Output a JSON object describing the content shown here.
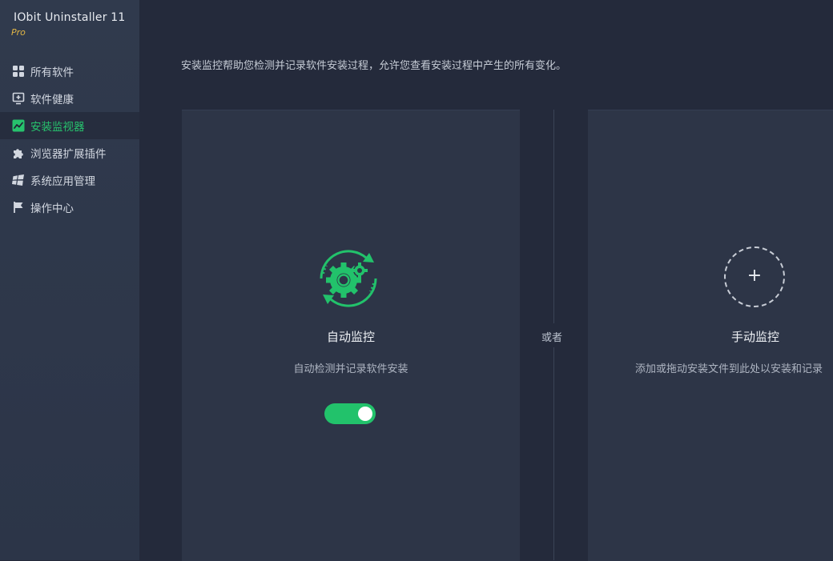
{
  "app": {
    "title": "IObit Uninstaller 11",
    "edition": "Pro"
  },
  "sidebar": {
    "items": [
      {
        "label": "所有软件",
        "icon": "grid-icon",
        "active": false
      },
      {
        "label": "软件健康",
        "icon": "monitor-plus-icon",
        "active": false
      },
      {
        "label": "安装监视器",
        "icon": "activity-chart-icon",
        "active": true
      },
      {
        "label": "浏览器扩展插件",
        "icon": "puzzle-icon",
        "active": false
      },
      {
        "label": "系统应用管理",
        "icon": "windows-icon",
        "active": false
      },
      {
        "label": "操作中心",
        "icon": "flag-icon",
        "active": false
      }
    ]
  },
  "main": {
    "description": "安装监控帮助您检测并记录软件安装过程，允许您查看安装过程中产生的所有变化。",
    "divider_text": "或者",
    "auto_card": {
      "icon": "gear-cycle-icon",
      "title": "自动监控",
      "subtitle": "自动检测并记录软件安装",
      "toggle_on": true
    },
    "manual_card": {
      "icon": "add-dashed-circle-icon",
      "plus": "+",
      "title": "手动监控",
      "subtitle": "添加或拖动安装文件到此处以安装和记录"
    }
  },
  "colors": {
    "accent": "#22c26b",
    "sidebar_bg": "#303a4d",
    "main_bg": "#242a3b",
    "card_bg": "#2d3547",
    "edition": "#e2b646"
  }
}
